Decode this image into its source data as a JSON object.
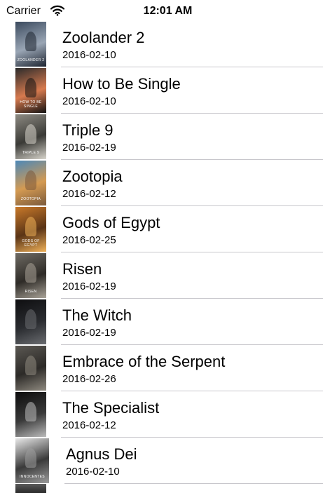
{
  "status_bar": {
    "carrier": "Carrier",
    "time": "12:01 AM"
  },
  "movies": [
    {
      "title": "Zoolander 2",
      "date": "2016-02-10",
      "poster_text": "ZOOLANDER 2",
      "poster_colors": [
        "#3b4a5e",
        "#9aa6b5",
        "#1d2430"
      ]
    },
    {
      "title": "How to Be Single",
      "date": "2016-02-10",
      "poster_text": "HOW TO BE SINGLE",
      "poster_colors": [
        "#2b2b2b",
        "#d77a4e",
        "#121212"
      ]
    },
    {
      "title": "Triple 9",
      "date": "2016-02-19",
      "poster_text": "TRIPLE 9",
      "poster_colors": [
        "#8d8a82",
        "#3a3a36",
        "#d8d5cc"
      ]
    },
    {
      "title": "Zootopia",
      "date": "2016-02-12",
      "poster_text": "ZOOTOPIA",
      "poster_colors": [
        "#4c88b8",
        "#d49a52",
        "#7b5a3c"
      ]
    },
    {
      "title": "Gods of Egypt",
      "date": "2016-02-25",
      "poster_text": "GODS OF EGYPT",
      "poster_colors": [
        "#c9792a",
        "#5a3416",
        "#f0b25a"
      ]
    },
    {
      "title": "Risen",
      "date": "2016-02-19",
      "poster_text": "RISEN",
      "poster_colors": [
        "#6e6a63",
        "#2e2b27",
        "#a9a398"
      ]
    },
    {
      "title": "The Witch",
      "date": "2016-02-19",
      "poster_text": "",
      "poster_colors": [
        "#0e0e10",
        "#2a2c30",
        "#6a6c70"
      ]
    },
    {
      "title": "Embrace of the Serpent",
      "date": "2016-02-26",
      "poster_text": "",
      "poster_colors": [
        "#5b5853",
        "#2c2a27",
        "#8f8a80"
      ]
    },
    {
      "title": "The Specialist",
      "date": "2016-02-12",
      "poster_text": "",
      "poster_colors": [
        "#0c0c0c",
        "#3a3a3a",
        "#bbbbbb"
      ]
    },
    {
      "title": "Agnus Dei",
      "date": "2016-02-10",
      "poster_text": "INNOCENTES",
      "poster_colors": [
        "#e9e9e9",
        "#3a3a3a",
        "#9c9c9c"
      ]
    }
  ]
}
